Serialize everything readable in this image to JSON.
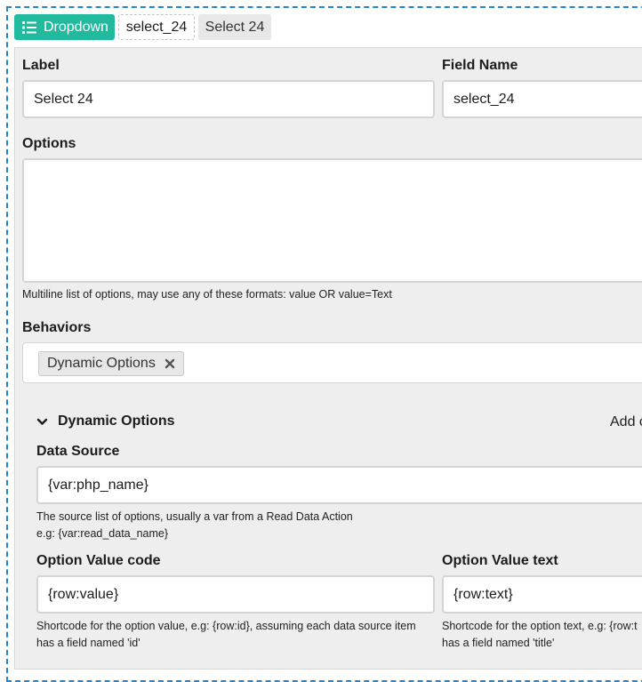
{
  "header": {
    "type_label": "Dropdown",
    "type_icon": "list-icon",
    "field_name": "select_24",
    "field_label": "Select 24"
  },
  "form": {
    "label": {
      "title": "Label",
      "value": "Select 24"
    },
    "field_name": {
      "title": "Field Name",
      "value": "select_24"
    },
    "options": {
      "title": "Options",
      "value": "",
      "help": "Multiline list of options, may use any of these formats: value OR value=Text"
    },
    "behaviors": {
      "title": "Behaviors",
      "tags": [
        {
          "label": "Dynamic Options",
          "remove_icon": "close-icon"
        }
      ]
    }
  },
  "dynamic_options": {
    "title": "Dynamic Options",
    "toggle_icon": "chevron-down-icon",
    "add_link": "Add c",
    "data_source": {
      "title": "Data Source",
      "value": "{var:php_name}",
      "help_line1": "The source list of options, usually a var from a Read Data Action",
      "help_line2": "e.g: {var:read_data_name}"
    },
    "option_value_code": {
      "title": "Option Value code",
      "value": "{row:value}",
      "help_line1": "Shortcode for the option value, e.g: {row:id}, assuming each data source item",
      "help_line2": "has a field named 'id'"
    },
    "option_value_text": {
      "title": "Option Value text",
      "value": "{row:text}",
      "help_line1": "Shortcode for the option text, e.g: {row:t",
      "help_line2": "has a field named 'title'"
    }
  },
  "colors": {
    "accent": "#21ba9f",
    "frame_border": "#2185d0",
    "panel_bg": "#eeeeee",
    "input_border": "#d4d4d5"
  }
}
